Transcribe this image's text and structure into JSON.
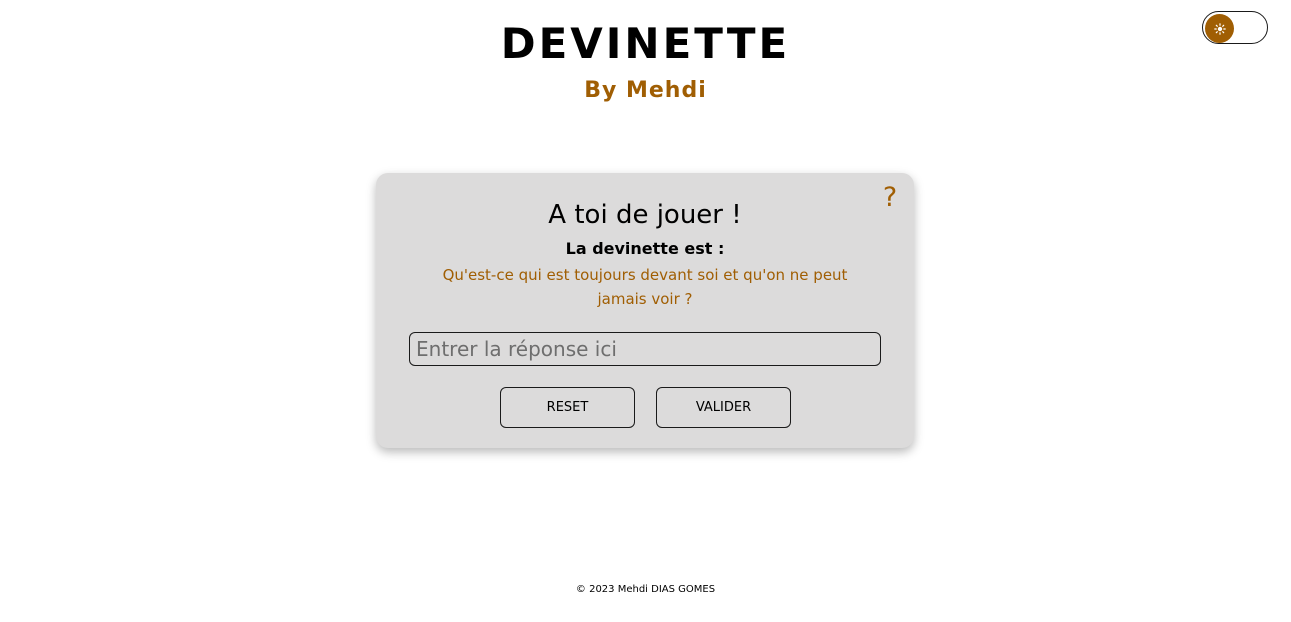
{
  "header": {
    "title": "DEVINETTE",
    "subtitle": "By Mehdi"
  },
  "theme_toggle": {
    "icon": "sun-icon",
    "state": "light"
  },
  "card": {
    "help_label": "?",
    "heading": "A toi de jouer !",
    "riddle_label": "La devinette est :",
    "riddle_text": "Qu'est-ce qui est toujours devant soi et qu'on ne peut jamais voir ?",
    "answer_input": {
      "value": "",
      "placeholder": "Entrer la réponse ici"
    },
    "reset_label": "RESET",
    "validate_label": "VALIDER"
  },
  "footer": {
    "copyright": "© 2023 Mehdi DIAS GOMES"
  },
  "colors": {
    "accent": "#a05e03",
    "card_background": "#dcdbdb",
    "page_background": "#ffffff",
    "text": "#000000"
  }
}
